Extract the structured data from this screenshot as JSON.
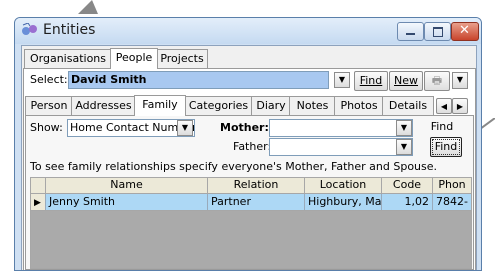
{
  "window": {
    "title": "Entities",
    "buttons": [
      "minimize",
      "maximize",
      "close"
    ]
  },
  "main_tabs": [
    {
      "label": "Organisations",
      "active": false
    },
    {
      "label": "People",
      "active": true
    },
    {
      "label": "Projects",
      "active": false
    }
  ],
  "select_row": {
    "label": "Select:",
    "value": "David Smith",
    "find_label": "Find",
    "new_label": "New"
  },
  "sub_tabs": [
    {
      "label": "Person",
      "active": false
    },
    {
      "label": "Addresses",
      "active": false
    },
    {
      "label": "Family",
      "active": true
    },
    {
      "label": "Categories",
      "active": false
    },
    {
      "label": "Diary",
      "active": false
    },
    {
      "label": "Notes",
      "active": false
    },
    {
      "label": "Photos",
      "active": false
    },
    {
      "label": "Details",
      "active": false
    }
  ],
  "family": {
    "show_label": "Show:",
    "show_value": "Home Contact Numbers",
    "mother_label": "Mother:",
    "mother_value": "",
    "father_label": "Father:",
    "father_value": "",
    "find_label": "Find",
    "hint": "To see family relationships specify everyone's Mother, Father and Spouse."
  },
  "grid": {
    "columns": [
      "Name",
      "Relation",
      "Location",
      "Code",
      "Phon"
    ],
    "rows": [
      [
        "Jenny Smith",
        "Partner",
        "Highbury, Ma",
        "1,02",
        "7842-"
      ]
    ]
  },
  "icons": {
    "app": "entities-app-icon",
    "print": "printer-icon",
    "row_selector": "row-pointer-icon",
    "scroll_left": "scroll-left-icon",
    "scroll_right": "scroll-right-icon"
  },
  "colors": {
    "selection": "#add8f5",
    "title_bar": "#c5daf1",
    "close_button": "#c8442c",
    "grid_empty": "#aaaaaa"
  }
}
